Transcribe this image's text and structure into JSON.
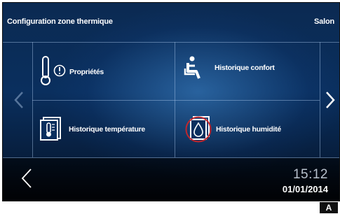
{
  "header": {
    "title": "Configuration zone thermique",
    "room": "Salon"
  },
  "tiles": [
    {
      "label": "Propriétés",
      "icon": "thermometer-info-icon"
    },
    {
      "label": "Historique confort",
      "icon": "seated-person-icon"
    },
    {
      "label": "Historique température",
      "icon": "temperature-history-icon"
    },
    {
      "label": "Historique humidité",
      "icon": "humidity-history-icon"
    }
  ],
  "footer": {
    "time": "15:12",
    "date": "01/01/2014"
  },
  "badge": "A"
}
